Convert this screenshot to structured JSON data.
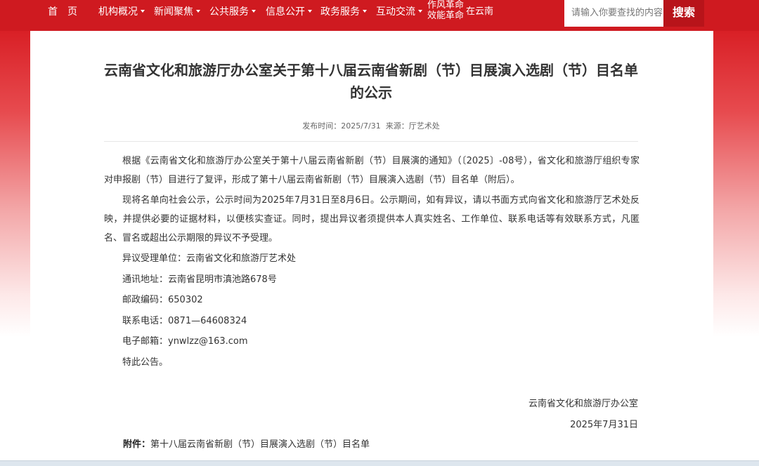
{
  "nav": {
    "home": "首　页",
    "items": [
      "机构概况",
      "新闻聚焦",
      "公共服务",
      "信息公开",
      "政务服务",
      "互动交流"
    ],
    "special_line1": "作风革命",
    "special_line2": "效能革命",
    "special_tail": "在云南",
    "search_placeholder": "请输入你要查找的内容",
    "search_button": "搜索"
  },
  "article": {
    "title": "云南省文化和旅游厅办公室关于第十八届云南省新剧（节）目展演入选剧（节）目名单的公示",
    "meta_date_label": "发布时间：",
    "meta_date": "2025/7/31",
    "meta_source_label": "来源：",
    "meta_source": "厅艺术处",
    "paragraphs": [
      "根据《云南省文化和旅游厅办公室关于第十八届云南省新剧（节）目展演的通知》（〔2025〕-08号），省文化和旅游厅组织专家对申报剧（节）目进行了复评，形成了第十八届云南省新剧（节）目展演入选剧（节）目名单（附后）。",
      "现将名单向社会公示，公示时间为2025年7月31日至8月6日。公示期间，如有异议，请以书面方式向省文化和旅游厅艺术处反映，并提供必要的证据材料，以便核实查证。同时，提出异议者须提供本人真实姓名、工作单位、联系电话等有效联系方式，凡匿名、冒名或超出公示期限的异议不予受理。"
    ],
    "lines": [
      "异议受理单位：云南省文化和旅游厅艺术处",
      "通讯地址：云南省昆明市滇池路678号",
      "邮政编码：650302",
      "联系电话：0871—64608324",
      "电子邮箱：ynwlzz@163.com",
      "特此公告。"
    ],
    "sign_org": "云南省文化和旅游厅办公室",
    "sign_date": "2025年7月31日",
    "attach_label": "附件：",
    "attach_text": "第十八届云南省新剧（节）目展演入选剧（节）目名单"
  }
}
